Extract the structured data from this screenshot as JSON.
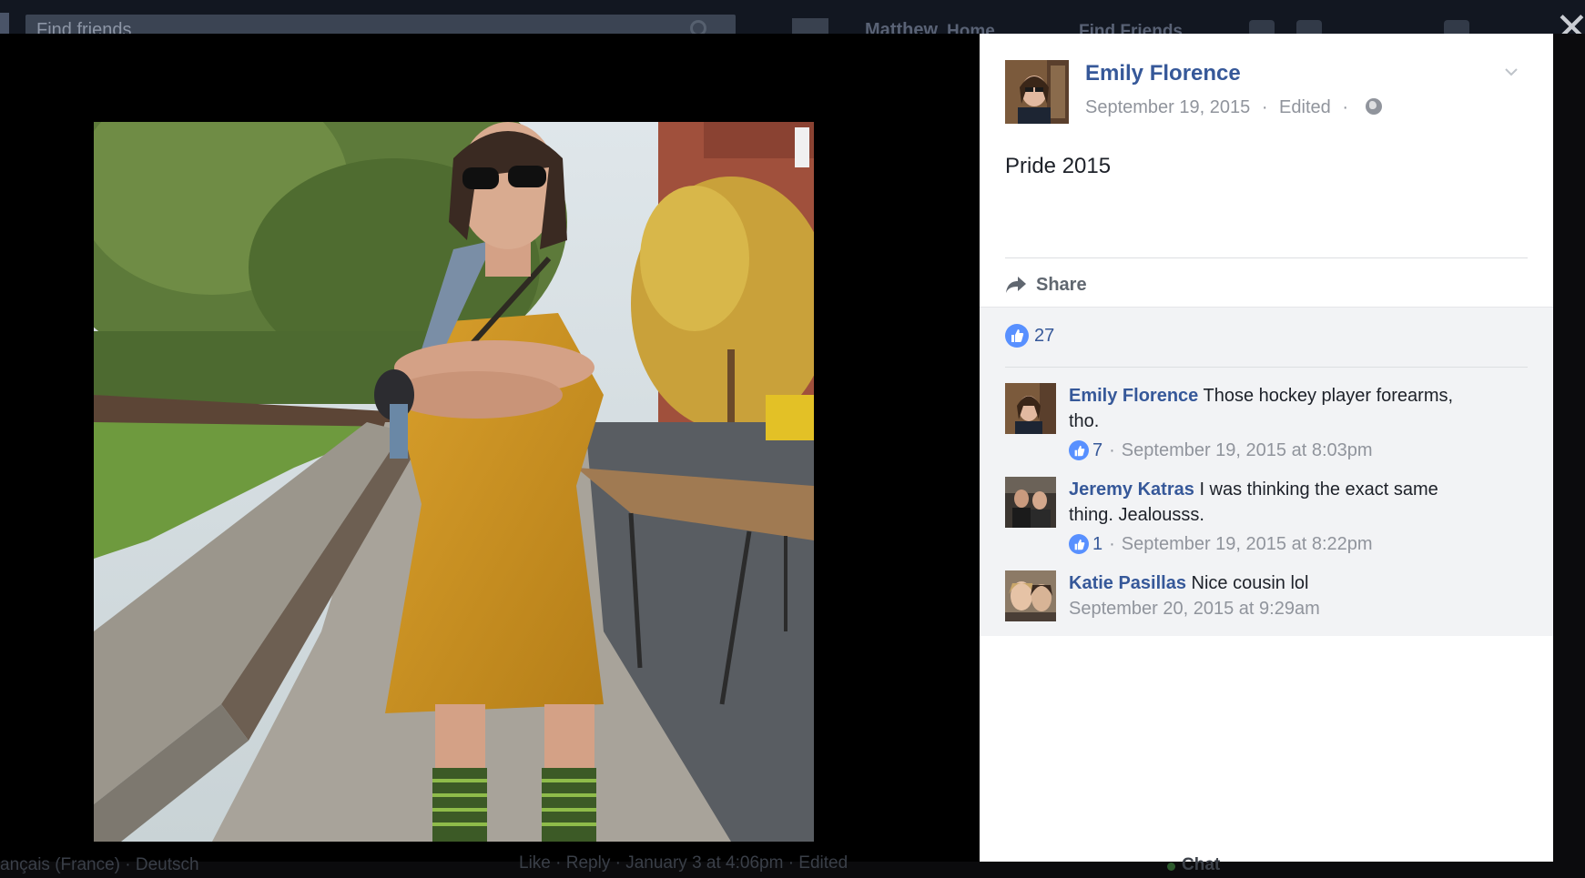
{
  "background": {
    "search_placeholder": "Find friends",
    "user_name": "Matthew",
    "home_label": "Home",
    "find_friends_label": "Find Friends",
    "footer_languages": "ançais (France) · Deutsch",
    "footer_actions": "Like · Reply · January 3 at 4:06pm · Edited",
    "chat_label": "Chat"
  },
  "lightbox": {
    "close_label": "✕"
  },
  "post": {
    "author": "Emily Florence",
    "date": "September 19, 2015",
    "edited": "Edited",
    "text": "Pride 2015",
    "share_label": "Share",
    "like_count": "27"
  },
  "comments": [
    {
      "name": "Emily Florence",
      "text": "Those hockey player forearms, tho.",
      "likes": "7",
      "timestamp": "September 19, 2015 at 8:03pm"
    },
    {
      "name": "Jeremy Katras",
      "text": "I was thinking the exact same thing. Jealousss.",
      "likes": "1",
      "timestamp": "September 19, 2015 at 8:22pm"
    },
    {
      "name": "Katie Pasillas",
      "text": "Nice cousin lol",
      "likes": "",
      "timestamp": "September 20, 2015 at 9:29am"
    }
  ],
  "icons": {
    "share": "share-arrow-icon",
    "like": "thumbs-up-icon",
    "privacy": "globe-icon",
    "options": "chevron-down-icon",
    "close": "close-icon"
  },
  "colors": {
    "link_blue": "#365899",
    "like_blue": "#5890ff",
    "meta_gray": "#90949c",
    "comment_bg": "#f2f3f5"
  }
}
